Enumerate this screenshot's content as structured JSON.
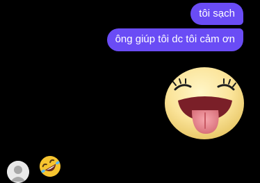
{
  "messages": [
    {
      "text": "tôi sạch",
      "sender": "me"
    },
    {
      "text": "ông giúp tôi dc tôi cảm ơn",
      "sender": "me"
    }
  ],
  "sticker": {
    "icon": "tongue-out-face-sticker"
  },
  "reply": {
    "avatar_icon": "default-avatar-icon",
    "emoji_icon": "rofl-emoji-icon"
  },
  "colors": {
    "background": "#000000",
    "bubble": "#6a4cf5",
    "bubble_text": "#ffffff"
  }
}
